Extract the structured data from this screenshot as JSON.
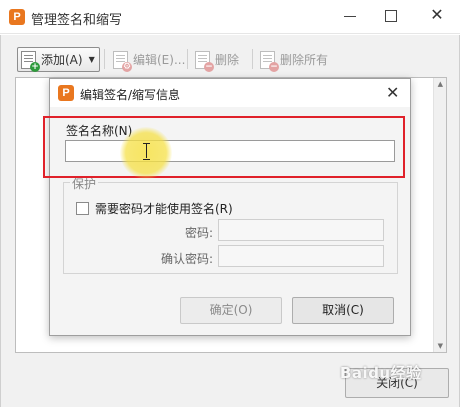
{
  "window": {
    "title": "管理签名和缩写",
    "logo_letter": "P",
    "close_glyph": "✕",
    "close_button_label": "关闭(C)"
  },
  "toolbar": {
    "add_label": "添加(A)",
    "edit_label": "编辑(E)...",
    "delete_label": "删除",
    "delete_all_label": "删除所有"
  },
  "dialog": {
    "title": "编辑签名/缩写信息",
    "logo_letter": "P",
    "close_glyph": "✕",
    "name_label": "签名名称(N)",
    "name_value": "",
    "protect_legend": "保护",
    "need_password_label": "需要密码才能使用签名(R)",
    "password_label": "密码:",
    "confirm_password_label": "确认密码:",
    "ok_label": "确定(O)",
    "cancel_label": "取消(C)"
  },
  "watermark": "Baidu经验",
  "colors": {
    "accent_logo": "#e9771f",
    "highlight": "#e0212a",
    "cursor_glow": "#f5e046"
  }
}
